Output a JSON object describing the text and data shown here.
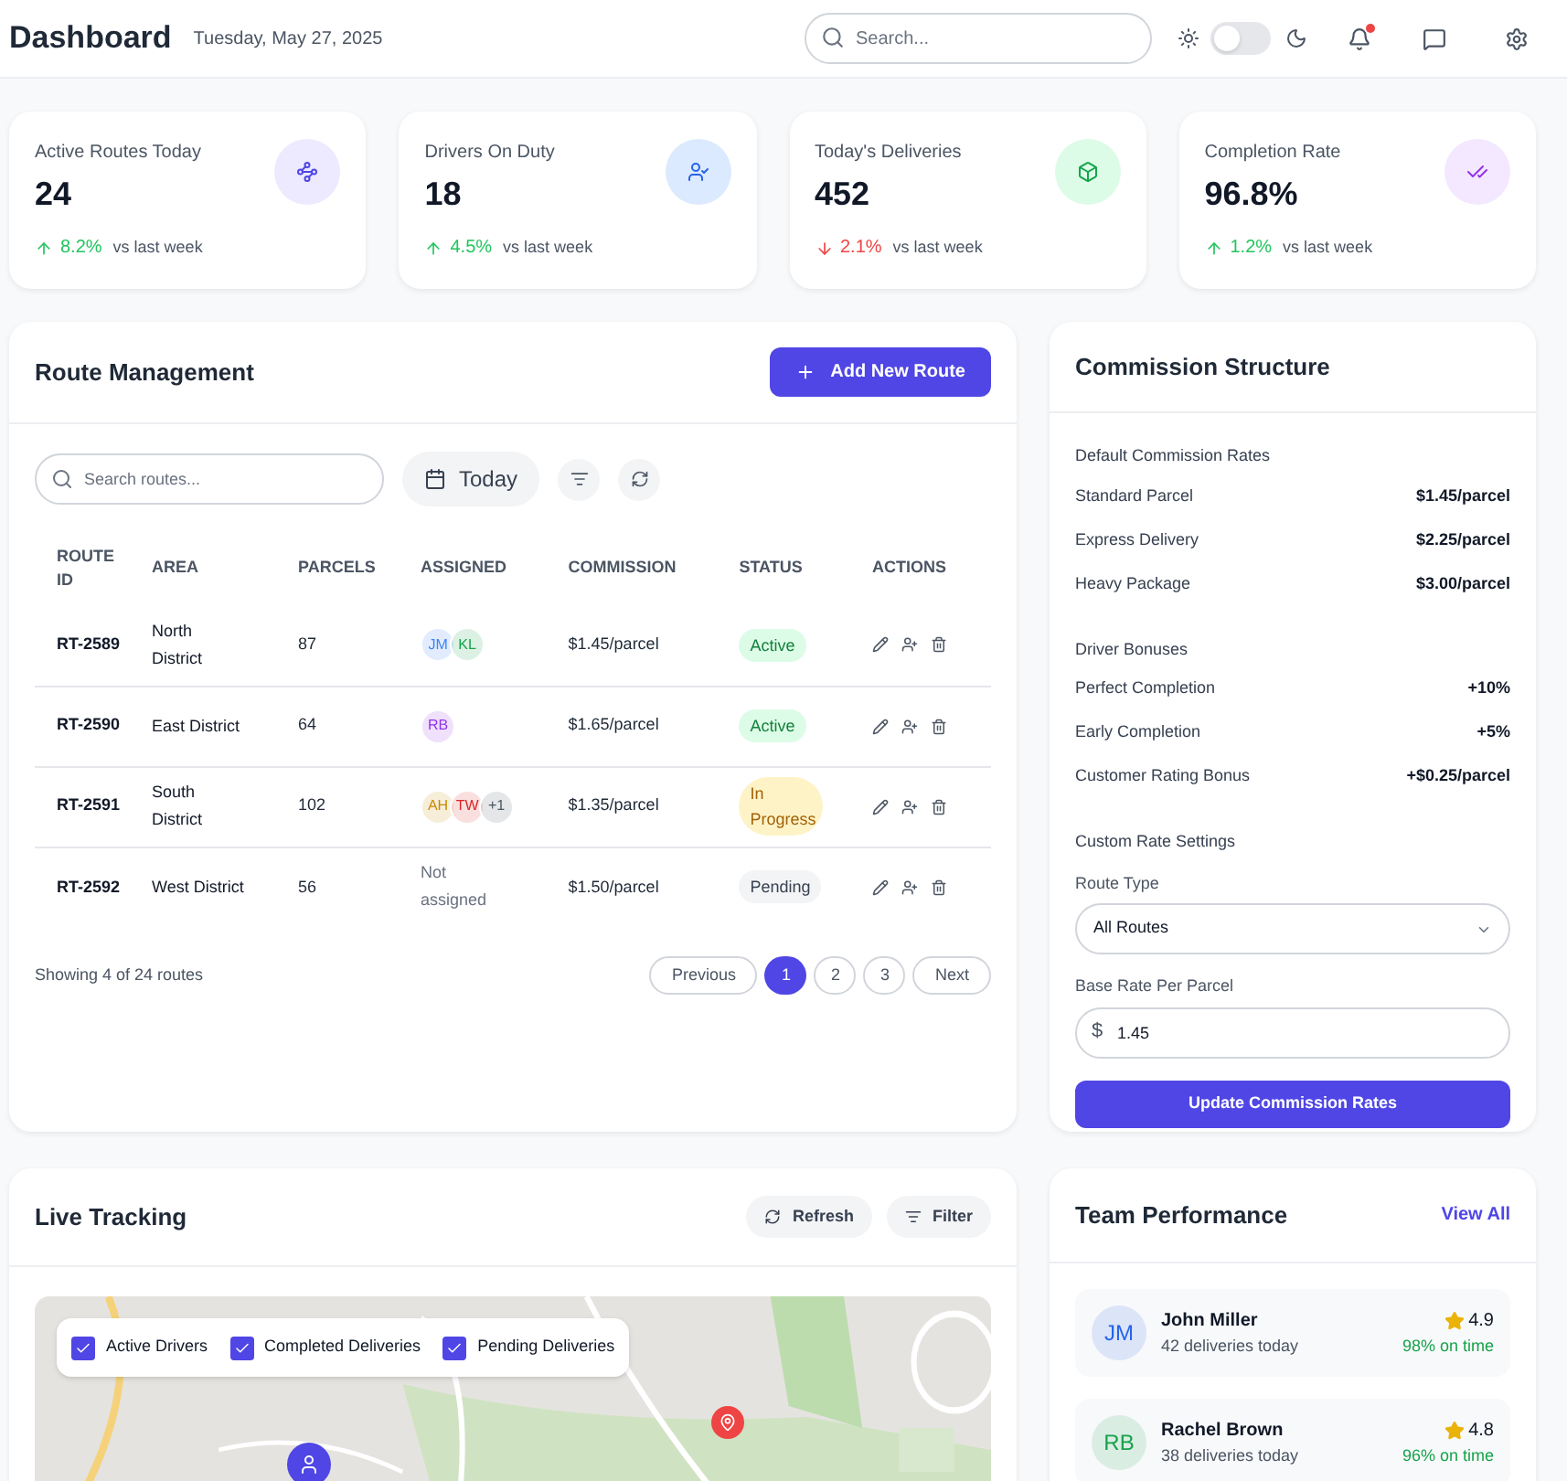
{
  "header": {
    "title": "Dashboard",
    "date": "Tuesday, May 27, 2025",
    "search_placeholder": "Search...",
    "dark_mode": false,
    "has_notifications": true
  },
  "stats": [
    {
      "label": "Active Routes Today",
      "value": "24",
      "change": "8.2%",
      "negative": false,
      "note": "vs last week"
    },
    {
      "label": "Drivers On Duty",
      "value": "18",
      "change": "4.5%",
      "negative": false,
      "note": "vs last week"
    },
    {
      "label": "Today's Deliveries",
      "value": "452",
      "change": "2.1%",
      "negative": true,
      "note": "vs last week"
    },
    {
      "label": "Completion Rate",
      "value": "96.8%",
      "change": "1.2%",
      "negative": false,
      "note": "vs last week"
    }
  ],
  "routes": {
    "title": "Route Management",
    "add_button": "Add New Route",
    "search_placeholder": "Search routes...",
    "date_filter": "Today",
    "columns": [
      "ROUTE ID",
      "AREA",
      "PARCELS",
      "ASSIGNED",
      "COMMISSION",
      "STATUS",
      "ACTIONS"
    ],
    "rows": [
      {
        "id": "RT-2589",
        "area": "North District",
        "parcels": "87",
        "assigned": [
          {
            "initials": "JM",
            "color": "#3b82f6"
          },
          {
            "initials": "KL",
            "color": "#16a34a"
          }
        ],
        "commission": "$1.45/parcel",
        "status": "Active",
        "kind": "active"
      },
      {
        "id": "RT-2590",
        "area": "East District",
        "parcels": "64",
        "assigned": [
          {
            "initials": "RB",
            "color": "#9333ea"
          }
        ],
        "commission": "$1.65/parcel",
        "status": "Active",
        "kind": "active"
      },
      {
        "id": "RT-2591",
        "area": "South District",
        "parcels": "102",
        "assigned": [
          {
            "initials": "AH",
            "color": "#ca8a04"
          },
          {
            "initials": "TW",
            "color": "#dc2626"
          },
          {
            "initials": "+1",
            "color": "#4b5563"
          }
        ],
        "commission": "$1.35/parcel",
        "status": "In Progress",
        "kind": "progress"
      },
      {
        "id": "RT-2592",
        "area": "West District",
        "parcels": "56",
        "unassigned": "Not assigned",
        "commission": "$1.50/parcel",
        "status": "Pending",
        "kind": "pending"
      }
    ],
    "footer": "Showing 4 of 24 routes",
    "pagination": [
      {
        "label": "Previous",
        "selected": false
      },
      {
        "label": "1",
        "selected": true
      },
      {
        "label": "2",
        "selected": false
      },
      {
        "label": "3",
        "selected": false
      },
      {
        "label": "Next",
        "selected": false
      }
    ]
  },
  "commission": {
    "title": "Commission Structure",
    "sections": [
      {
        "heading": "Default Commission Rates",
        "items": [
          {
            "label": "Standard Parcel",
            "value": "$1.45/parcel"
          },
          {
            "label": "Express Delivery",
            "value": "$2.25/parcel"
          },
          {
            "label": "Heavy Package",
            "value": "$3.00/parcel"
          }
        ]
      },
      {
        "heading": "Driver Bonuses",
        "items": [
          {
            "label": "Perfect Completion",
            "value": "+10%"
          },
          {
            "label": "Early Completion",
            "value": "+5%"
          },
          {
            "label": "Customer Rating Bonus",
            "value": "+$0.25/parcel"
          }
        ]
      }
    ],
    "custom_heading": "Custom Rate Settings",
    "route_type_label": "Route Type",
    "route_type": "All Routes",
    "base_rate_label": "Base Rate Per Parcel",
    "currency": "$",
    "base_rate": "1.45",
    "submit": "Update Commission Rates"
  },
  "tracking": {
    "title": "Live Tracking",
    "refresh": "Refresh",
    "filter": "Filter",
    "layers": [
      {
        "label": "Active Drivers",
        "checked": true
      },
      {
        "label": "Completed Deliveries",
        "checked": true
      },
      {
        "label": "Pending Deliveries",
        "checked": true
      }
    ]
  },
  "team": {
    "title": "Team Performance",
    "view_all": "View All",
    "members": [
      {
        "initials": "JM",
        "name": "John Miller",
        "sub": "42 deliveries today",
        "rating": "4.9",
        "on_time": "98% on time",
        "color": "#2563eb"
      },
      {
        "initials": "RB",
        "name": "Rachel Brown",
        "sub": "38 deliveries today",
        "rating": "4.8",
        "on_time": "96% on time",
        "color": "#16a34a"
      }
    ]
  }
}
